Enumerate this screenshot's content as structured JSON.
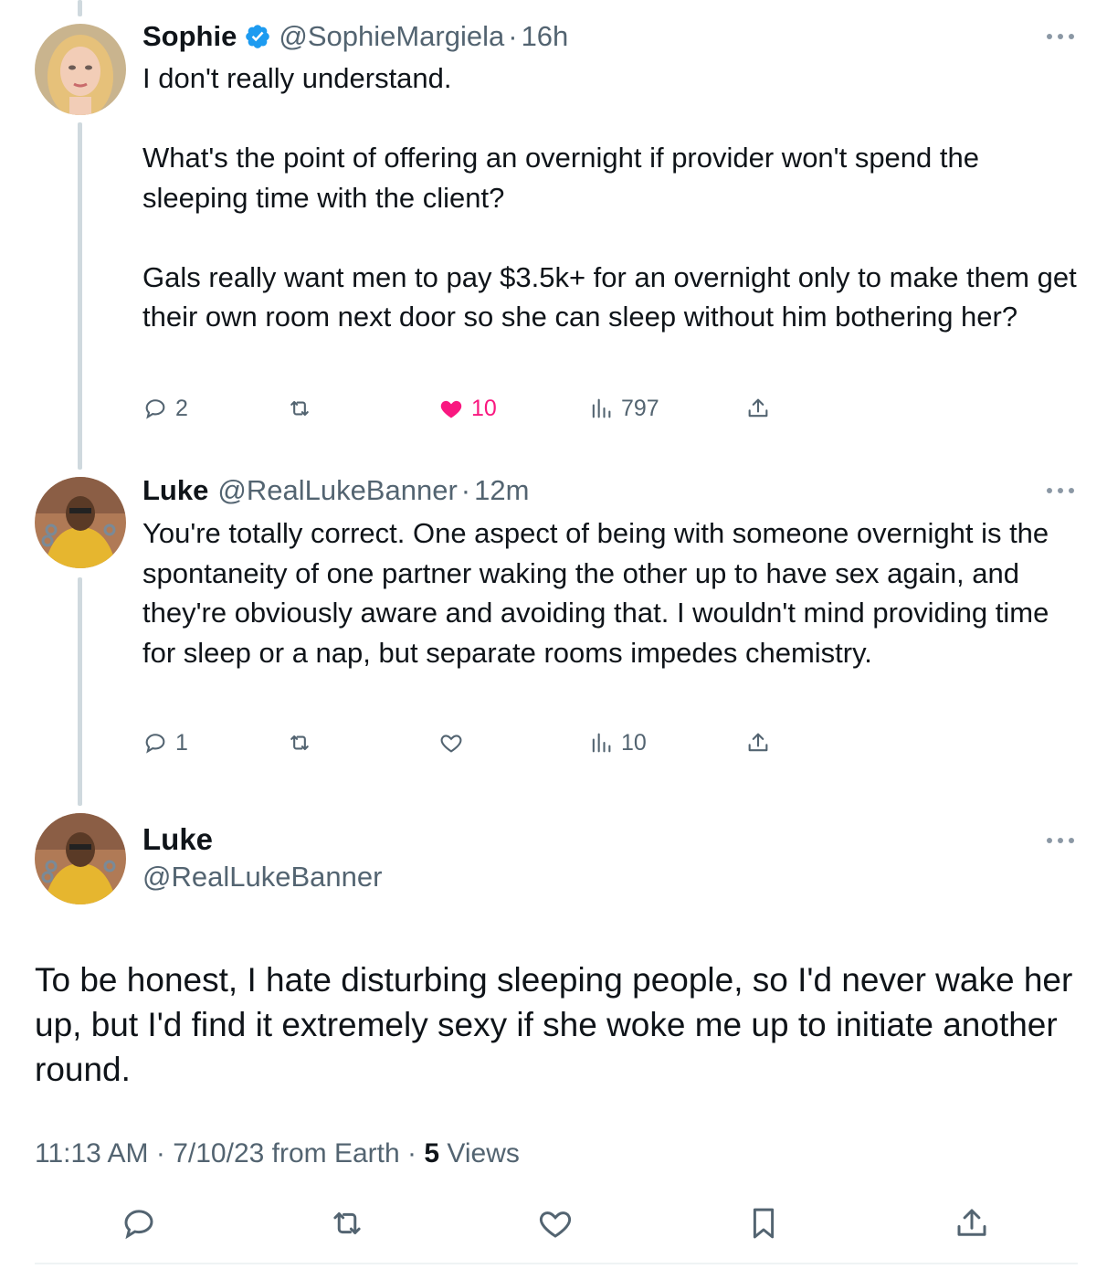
{
  "tweets": [
    {
      "name": "Sophie",
      "verified": true,
      "handle": "@SophieMargiela",
      "dot": "·",
      "time": "16h",
      "text": "I don't really understand.\n\nWhat's the point of offering an overnight if provider won't spend the sleeping time with the client?\n\nGals really want men to pay $3.5k+ for an overnight only to make them get their own room next door so she can sleep without him bothering her?",
      "replies": "2",
      "likes": "10",
      "liked": true,
      "views": "797"
    },
    {
      "name": "Luke",
      "verified": false,
      "handle": "@RealLukeBanner",
      "dot": "·",
      "time": "12m",
      "text": "You're totally correct.  One aspect of being with someone overnight is the spontaneity of one partner waking the other up to have sex again, and they're obviously aware and avoiding that. I wouldn't mind providing time for sleep or a nap, but separate rooms impedes chemistry.",
      "replies": "1",
      "likes": "",
      "liked": false,
      "views": "10"
    }
  ],
  "main_tweet": {
    "name": "Luke",
    "handle": "@RealLukeBanner",
    "text": "To be honest, I hate disturbing sleeping people, so I'd never wake her up, but I'd find it extremely sexy if she woke me up to initiate another round.",
    "time": "11:13 AM",
    "date": "7/10/23",
    "source": "from Earth",
    "dot": "·",
    "views_count": "5",
    "views_label": "Views"
  },
  "colors": {
    "text": "#0f1419",
    "secondary": "#536471",
    "verified": "#1d9bf0",
    "like": "#f91880",
    "thread_line": "#cfd9de"
  },
  "icons": [
    "reply-icon",
    "retweet-icon",
    "like-icon",
    "views-icon",
    "share-icon",
    "bookmark-icon",
    "more-icon",
    "verified-badge-icon"
  ]
}
